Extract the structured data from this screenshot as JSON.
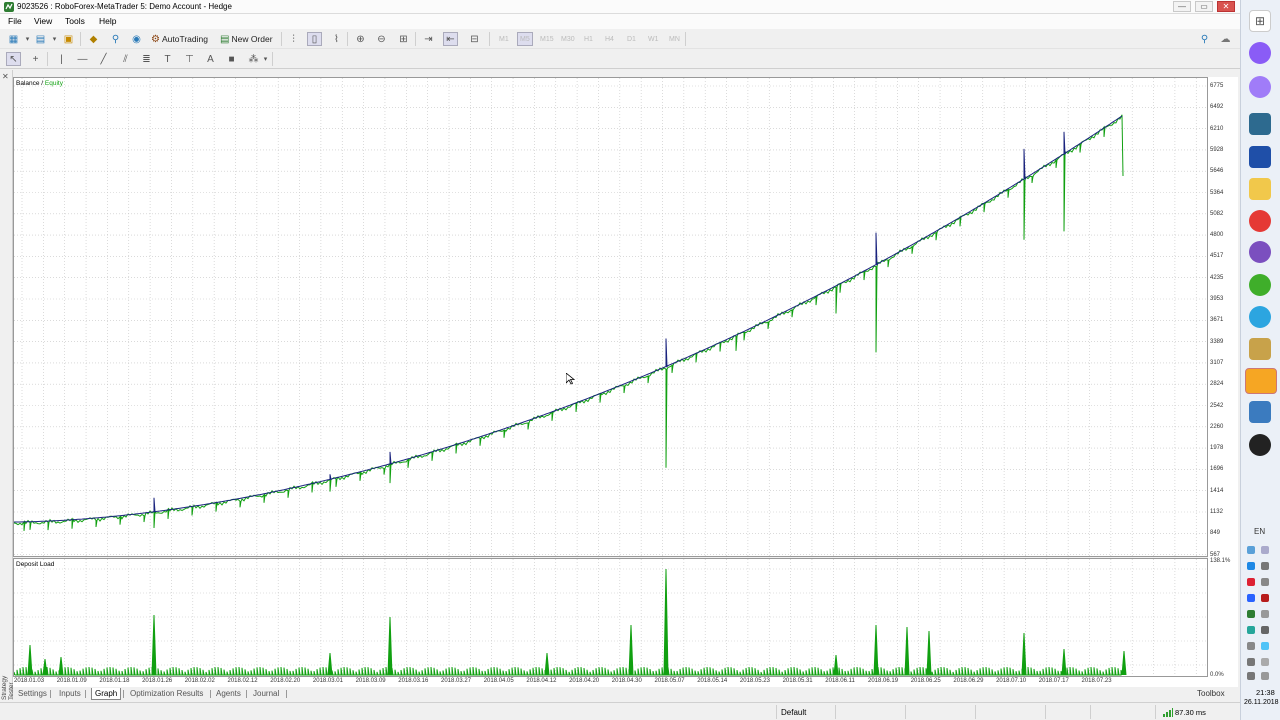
{
  "window": {
    "title": "9023526 : RoboForex-MetaTrader 5: Demo Account - Hedge",
    "buttons": {
      "minimize": "—",
      "restore": "▭",
      "close": "✕"
    }
  },
  "menu": {
    "items": [
      "File",
      "View",
      "Tools",
      "Help"
    ]
  },
  "toolbar": {
    "autotrading_label": "AutoTrading",
    "new_order_label": "New Order",
    "timeframes": [
      "M1",
      "M5",
      "M15",
      "M30",
      "H1",
      "H4",
      "D1",
      "W1",
      "MN"
    ],
    "active_timeframe": "M5"
  },
  "chart": {
    "legend_balance": "Balance",
    "legend_sep": " / ",
    "legend_equity": "Equity",
    "deposit_label": "Deposit Load",
    "side_label": "Strategy Tester",
    "price_ticks": [
      "6775",
      "6492",
      "6210",
      "5928",
      "5646",
      "5364",
      "5082",
      "4800",
      "4517",
      "4235",
      "3953",
      "3671",
      "3389",
      "3107",
      "2824",
      "2542",
      "2260",
      "1978",
      "1696",
      "1414",
      "1132",
      "849",
      "567"
    ],
    "deposit_ticks": [
      "138.1%",
      "0.0%"
    ],
    "date_ticks": [
      "2018.01.03",
      "2018.01.09",
      "2018.01.18",
      "2018.01.26",
      "2018.02.02",
      "2018.02.12",
      "2018.02.20",
      "2018.03.01",
      "2018.03.09",
      "2018.03.16",
      "2018.03.27",
      "2018.04.05",
      "2018.04.12",
      "2018.04.20",
      "2018.04.30",
      "2018.05.07",
      "2018.05.14",
      "2018.05.23",
      "2018.05.31",
      "2018.06.11",
      "2018.06.19",
      "2018.06.25",
      "2018.06.29",
      "2018.07.10",
      "2018.07.17",
      "2018.07.23"
    ],
    "colors": {
      "balance": "#1a237e",
      "equity": "#11a011",
      "deposit": "#11a011",
      "grid": "#c4c4c4"
    }
  },
  "tabs": {
    "items": [
      "Settings",
      "Inputs",
      "Graph",
      "Optimization Results",
      "Agents",
      "Journal"
    ],
    "active": "Graph",
    "toolbox": "Toolbox"
  },
  "status": {
    "profile": "Default",
    "ping": "87.30 ms"
  },
  "taskbar": {
    "lang": "EN",
    "time": "21:38",
    "date": "26.11.2018",
    "apps": [
      "alice-icon",
      "alice-voice-icon",
      "scanner-icon",
      "save-icon",
      "folder-icon",
      "yandex-browser-icon",
      "viber-icon",
      "settings-flower-icon",
      "telegram-icon",
      "cash-icon",
      "metatrader-icon",
      "terminal-icon",
      "obs-icon"
    ]
  }
}
